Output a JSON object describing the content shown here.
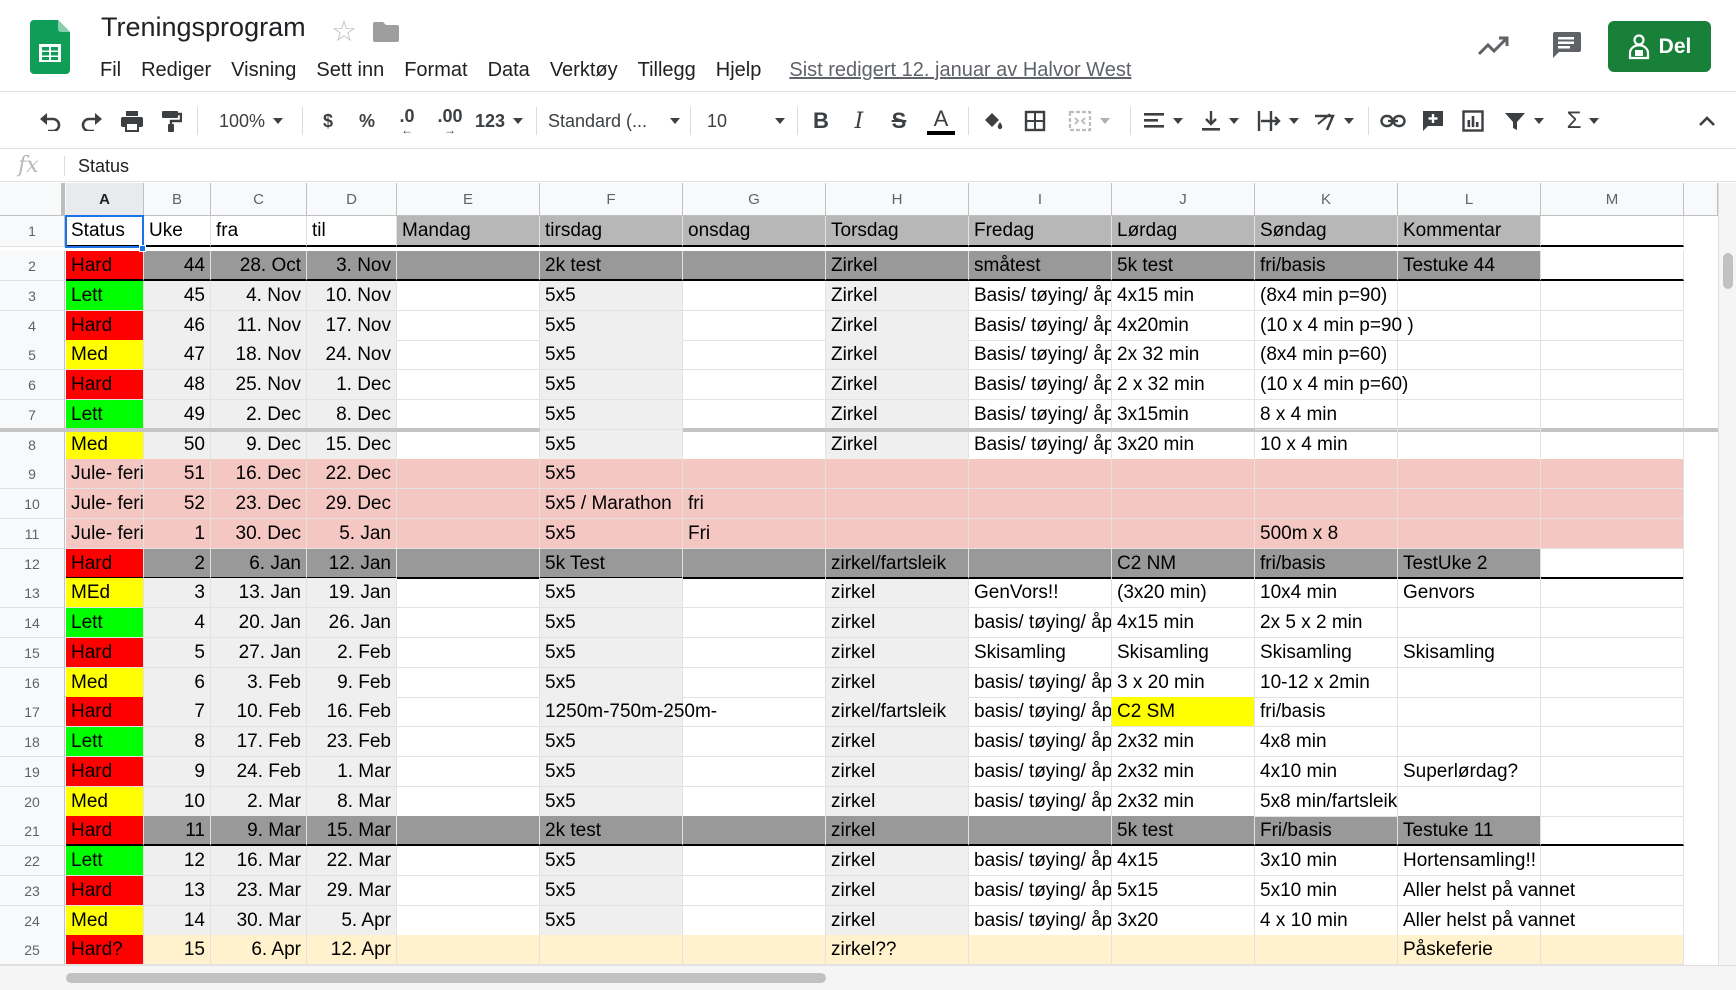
{
  "app": {
    "title": "Treningsprogram",
    "menu": [
      "Fil",
      "Rediger",
      "Visning",
      "Sett inn",
      "Format",
      "Data",
      "Verktøy",
      "Tillegg",
      "Hjelp"
    ],
    "last_edit": "Sist redigert 12. januar av Halvor West",
    "share_label": "Del"
  },
  "toolbar": {
    "zoom": "100%",
    "currency": "$",
    "percent": "%",
    "dec_less": ".0",
    "dec_more": ".00",
    "number_format": "123",
    "font": "Standard (...",
    "font_size": "10",
    "bold": "B",
    "italic": "I",
    "strike": "S",
    "text_color": "A",
    "sigma": "Σ"
  },
  "formula": {
    "fx": "fx",
    "value": "Status"
  },
  "colors": {
    "red": "#ff0000",
    "green": "#00ff00",
    "yellow": "#ffff00",
    "dark_gray": "#999999",
    "header_gray": "#b7b7b7",
    "pink": "#f4c7c3",
    "light_yellow": "#fff2cc",
    "band": "#efefef",
    "selection": "#1a73e8",
    "share_green": "#188038"
  },
  "sheet": {
    "columns": [
      "A",
      "B",
      "C",
      "D",
      "E",
      "F",
      "G",
      "H",
      "I",
      "J",
      "K",
      "L",
      "M"
    ],
    "selected_cell": "A1",
    "rows": [
      {
        "n": "1",
        "cells": [
          "Status",
          "Uke",
          "fra",
          "til",
          "Mandag",
          "tirsdag",
          "onsdag",
          "Torsdag",
          "Fredag",
          "Lørdag",
          "Søndag",
          "Kommentar",
          ""
        ]
      },
      {
        "n": "2",
        "cells": [
          "Hard",
          "44",
          "28. Oct",
          "3. Nov",
          "",
          "2k test",
          "",
          "Zirkel",
          "småtest",
          "5k test",
          "fri/basis",
          "Testuke 44",
          ""
        ]
      },
      {
        "n": "3",
        "cells": [
          "Lett",
          "45",
          "4. Nov",
          "10. Nov",
          "",
          "5x5",
          "",
          "Zirkel",
          "Basis/ tøying/ åpen",
          "4x15 min",
          "(8x4 min p=90)",
          "",
          ""
        ]
      },
      {
        "n": "4",
        "cells": [
          "Hard",
          "46",
          "11. Nov",
          "17. Nov",
          "",
          "5x5",
          "",
          "Zirkel",
          "Basis/ tøying/ åpen",
          "4x20min",
          "(10 x 4 min p=90 )",
          "",
          ""
        ]
      },
      {
        "n": "5",
        "cells": [
          "Med",
          "47",
          "18. Nov",
          "24. Nov",
          "",
          "5x5",
          "",
          "Zirkel",
          "Basis/ tøying/ åpen",
          "2x 32 min",
          "(8x4 min p=60)",
          "",
          ""
        ]
      },
      {
        "n": "6",
        "cells": [
          "Hard",
          "48",
          "25. Nov",
          "1. Dec",
          "",
          "5x5",
          "",
          "Zirkel",
          "Basis/ tøying/ åpen",
          "2 x 32 min",
          "(10 x 4 min p=60)",
          "",
          ""
        ]
      },
      {
        "n": "7",
        "cells": [
          "Lett",
          "49",
          "2. Dec",
          "8. Dec",
          "",
          "5x5",
          "",
          "Zirkel",
          "Basis/ tøying/ åpen",
          "3x15min",
          "8 x 4 min",
          "",
          ""
        ]
      },
      {
        "n": "8",
        "cells": [
          "Med",
          "50",
          "9. Dec",
          "15. Dec",
          "",
          "5x5",
          "",
          "Zirkel",
          "Basis/ tøying/ åpen",
          "3x20 min",
          "10 x 4 min",
          "",
          ""
        ]
      },
      {
        "n": "9",
        "cells": [
          "Jule- ferie",
          "51",
          "16. Dec",
          "22. Dec",
          "",
          "5x5",
          "",
          "",
          "",
          "",
          "",
          "",
          ""
        ]
      },
      {
        "n": "10",
        "cells": [
          "Jule- ferie",
          "52",
          "23. Dec",
          "29. Dec",
          "",
          "5x5 / Marathon",
          "fri",
          "",
          "",
          "",
          "",
          "",
          ""
        ]
      },
      {
        "n": "11",
        "cells": [
          "Jule- ferie",
          "1",
          "30. Dec",
          "5. Jan",
          "",
          "5x5",
          "Fri",
          "",
          "",
          "",
          "500m x 8",
          "",
          ""
        ]
      },
      {
        "n": "12",
        "cells": [
          "Hard",
          "2",
          "6. Jan",
          "12. Jan",
          "",
          "5k Test",
          "",
          "zirkel/fartsleik",
          "",
          "C2 NM",
          "fri/basis",
          "TestUke 2",
          ""
        ]
      },
      {
        "n": "13",
        "cells": [
          "MEd",
          "3",
          "13. Jan",
          "19. Jan",
          "",
          "5x5",
          "",
          "zirkel",
          "GenVors!!",
          "(3x20 min)",
          "10x4 min",
          "Genvors",
          ""
        ]
      },
      {
        "n": "14",
        "cells": [
          "Lett",
          "4",
          "20. Jan",
          "26. Jan",
          "",
          "5x5",
          "",
          "zirkel",
          "basis/ tøying/ åpen",
          "4x15 min",
          "2x 5 x 2 min",
          "",
          ""
        ]
      },
      {
        "n": "15",
        "cells": [
          "Hard",
          "5",
          "27. Jan",
          "2. Feb",
          "",
          "5x5",
          "",
          "zirkel",
          "Skisamling",
          "Skisamling",
          "Skisamling",
          "Skisamling",
          ""
        ]
      },
      {
        "n": "16",
        "cells": [
          "Med",
          "6",
          "3. Feb",
          "9. Feb",
          "",
          "5x5",
          "",
          "zirkel",
          "basis/ tøying/ åpen",
          "3 x 20 min",
          "10-12 x 2min",
          "",
          ""
        ]
      },
      {
        "n": "17",
        "cells": [
          "Hard",
          "7",
          "10. Feb",
          "16. Feb",
          "",
          "1250m-750m-250m-",
          "",
          "zirkel/fartsleik",
          "basis/ tøying/ åpen",
          "C2 SM",
          "fri/basis",
          "",
          ""
        ]
      },
      {
        "n": "18",
        "cells": [
          "Lett",
          "8",
          "17. Feb",
          "23. Feb",
          "",
          "5x5",
          "",
          "zirkel",
          "basis/ tøying/ åpen",
          "2x32 min",
          "4x8 min",
          "",
          ""
        ]
      },
      {
        "n": "19",
        "cells": [
          "Hard",
          "9",
          "24. Feb",
          "1. Mar",
          "",
          "5x5",
          "",
          "zirkel",
          "basis/ tøying/ åpen",
          "2x32 min",
          "4x10 min",
          "Superlørdag?",
          ""
        ]
      },
      {
        "n": "20",
        "cells": [
          "Med",
          "10",
          "2. Mar",
          "8. Mar",
          "",
          "5x5",
          "",
          "zirkel",
          "basis/ tøying/ åpen",
          "2x32 min",
          "5x8 min/fartsleik",
          "",
          ""
        ]
      },
      {
        "n": "21",
        "cells": [
          "Hard",
          "11",
          "9. Mar",
          "15. Mar",
          "",
          "2k test",
          "",
          "zirkel",
          "",
          "5k test",
          "Fri/basis",
          "Testuke 11",
          ""
        ]
      },
      {
        "n": "22",
        "cells": [
          "Lett",
          "12",
          "16. Mar",
          "22. Mar",
          "",
          "5x5",
          "",
          "zirkel",
          "basis/ tøying/ åpen",
          "4x15",
          "3x10 min",
          "Hortensamling!!",
          ""
        ]
      },
      {
        "n": "23",
        "cells": [
          "Hard",
          "13",
          "23. Mar",
          "29. Mar",
          "",
          "5x5",
          "",
          "zirkel",
          "basis/ tøying/ åpen",
          "5x15",
          "5x10 min",
          "Aller helst på vannet",
          ""
        ]
      },
      {
        "n": "24",
        "cells": [
          "Med",
          "14",
          "30. Mar",
          "5. Apr",
          "",
          "5x5",
          "",
          "zirkel",
          "basis/ tøying/ åpen",
          "3x20",
          "4 x 10 min",
          "Aller helst på vannet",
          ""
        ]
      },
      {
        "n": "25",
        "cells": [
          "Hard?",
          "15",
          "6. Apr",
          "12. Apr",
          "",
          "",
          "",
          "zirkel??",
          "",
          "",
          "",
          "Påskeferie",
          ""
        ]
      }
    ]
  }
}
